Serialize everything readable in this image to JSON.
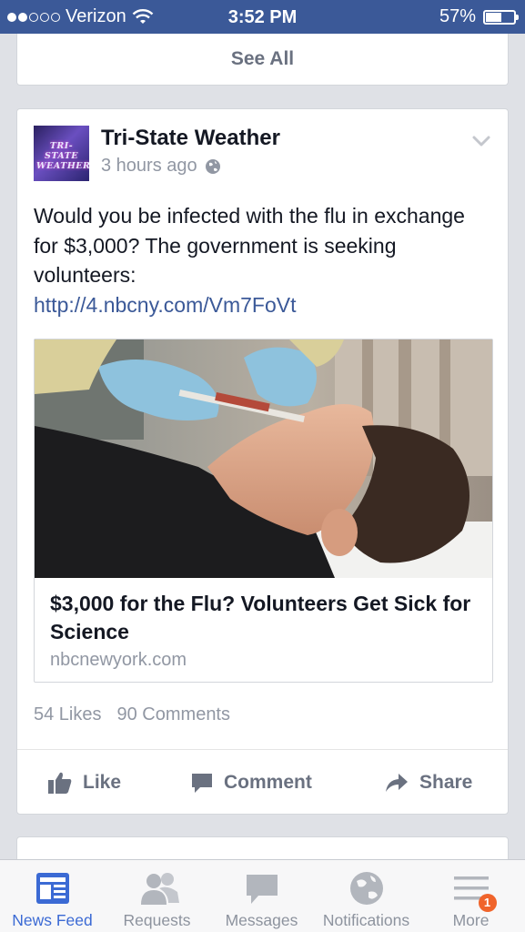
{
  "status_bar": {
    "carrier": "Verizon",
    "time": "3:52 PM",
    "battery_percent_label": "57%",
    "battery_level": 0.57
  },
  "see_all_card": {
    "label": "See All"
  },
  "post": {
    "page_name": "Tri-State Weather",
    "avatar_text": "TRI-STATE WEATHER",
    "timestamp": "3 hours ago",
    "text": "Would you be infected with the flu in exchange for $3,000? The government is seeking volunteers:",
    "link": "http://4.nbcny.com/Vm7FoVt",
    "preview": {
      "title": "$3,000 for the Flu? Volunteers Get Sick for Science",
      "domain": "nbcnewyork.com"
    },
    "likes": "54 Likes",
    "comments": "90 Comments",
    "actions": {
      "like": "Like",
      "comment": "Comment",
      "share": "Share"
    }
  },
  "tab_bar": {
    "tabs": [
      {
        "label": "News Feed",
        "icon": "news-feed-icon",
        "active": true
      },
      {
        "label": "Requests",
        "icon": "friend-requests-icon",
        "active": false
      },
      {
        "label": "Messages",
        "icon": "messages-icon",
        "active": false
      },
      {
        "label": "Notifications",
        "icon": "globe-icon",
        "active": false
      },
      {
        "label": "More",
        "icon": "menu-icon",
        "active": false,
        "badge": "1"
      }
    ]
  },
  "colors": {
    "brand": "#3b5998",
    "active_tab": "#3b6ad4",
    "muted_text": "#9197a3",
    "badge": "#f0642b"
  }
}
